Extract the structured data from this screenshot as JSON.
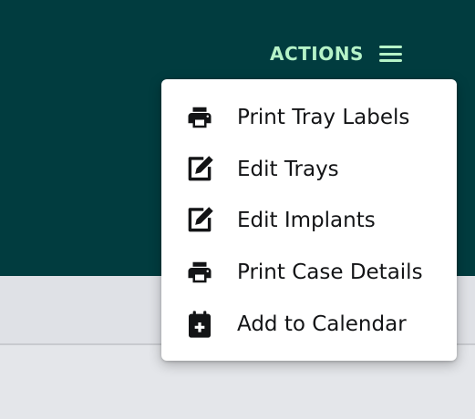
{
  "header": {
    "actions_label": "ACTIONS",
    "actions_icon": "hamburger-menu-icon",
    "background_color": "#013c3f",
    "accent_color": "#b6f3c8"
  },
  "menu": {
    "items": [
      {
        "label": "Print Tray Labels",
        "icon": "printer-icon"
      },
      {
        "label": "Edit Trays",
        "icon": "edit-icon"
      },
      {
        "label": "Edit Implants",
        "icon": "edit-icon"
      },
      {
        "label": "Print Case Details",
        "icon": "printer-icon"
      },
      {
        "label": "Add to Calendar",
        "icon": "calendar-add-icon"
      }
    ]
  }
}
